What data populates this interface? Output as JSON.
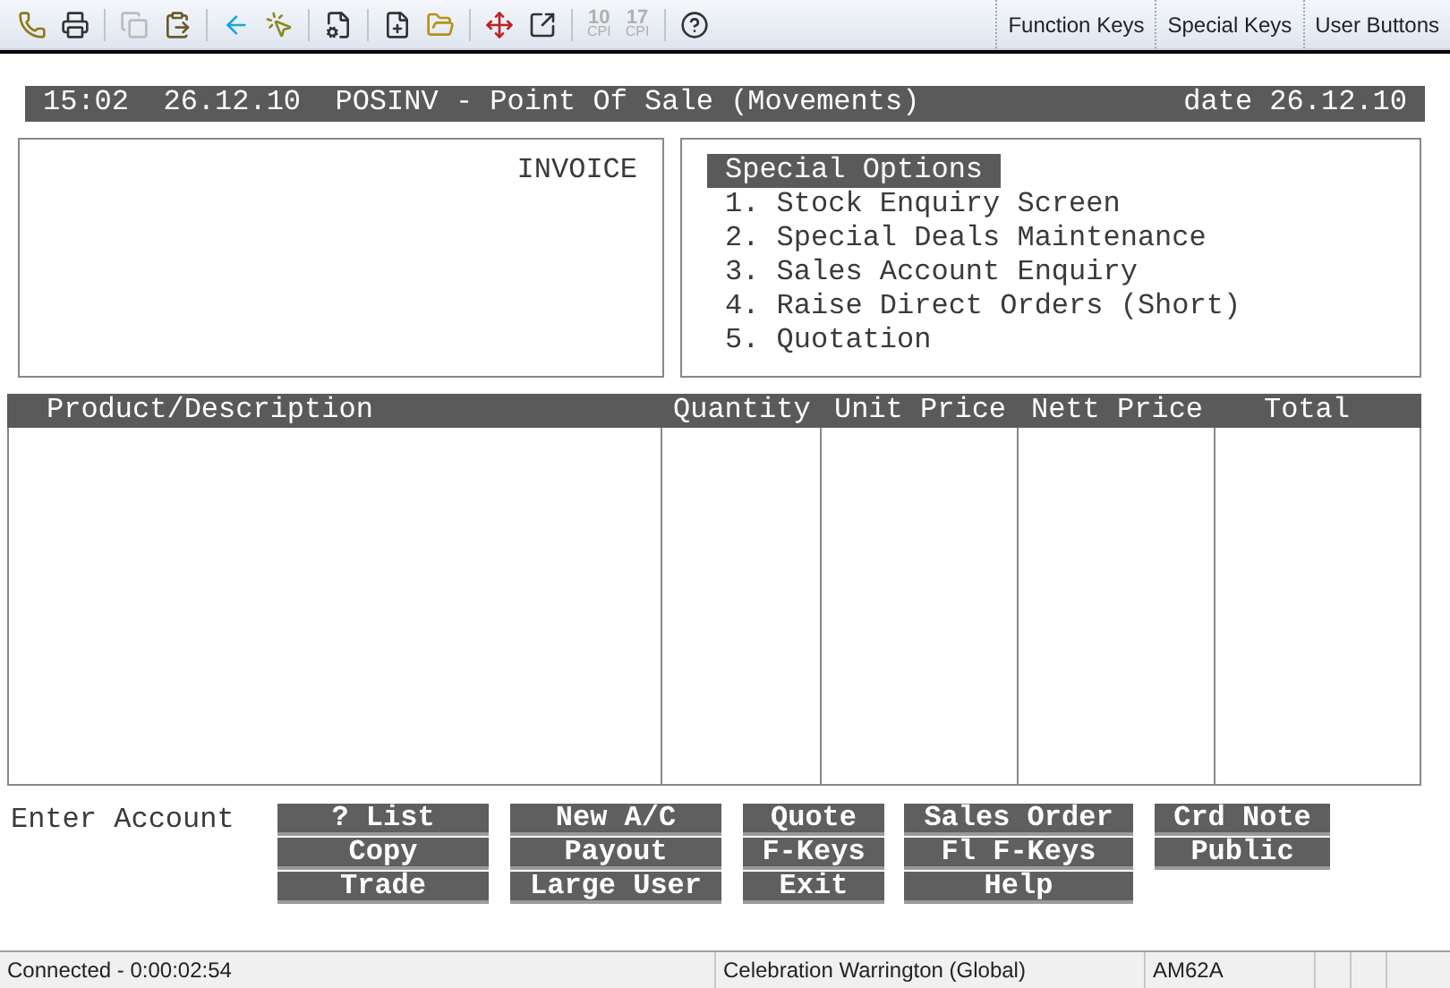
{
  "toolbar": {
    "items": [
      {
        "kind": "phone",
        "disabled": false
      },
      {
        "kind": "printer",
        "disabled": false
      },
      {
        "kind": "copy",
        "disabled": true
      },
      {
        "kind": "paste",
        "disabled": false
      },
      {
        "kind": "back",
        "disabled": false
      },
      {
        "kind": "pointer",
        "disabled": false
      },
      {
        "kind": "properties",
        "disabled": false
      },
      {
        "kind": "new",
        "disabled": false
      },
      {
        "kind": "open",
        "disabled": false
      },
      {
        "kind": "move",
        "disabled": false
      },
      {
        "kind": "export",
        "disabled": false
      },
      {
        "kind": "cpi",
        "number": "10",
        "unit": "CPI",
        "disabled": true
      },
      {
        "kind": "cpi",
        "number": "17",
        "unit": "CPI",
        "disabled": true
      },
      {
        "kind": "help",
        "disabled": false
      }
    ],
    "tabs": [
      "Function Keys",
      "Special Keys",
      "User Buttons"
    ]
  },
  "header": {
    "left": "15:02  26.12.10  POSINV - Point Of Sale (Movements)",
    "right": "date 26.12.10"
  },
  "invoice_panel": {
    "title": "INVOICE"
  },
  "special_options": {
    "title": "Special Options",
    "items": [
      "1. Stock Enquiry Screen",
      "2. Special Deals Maintenance",
      "3. Sales Account Enquiry",
      "4. Raise Direct Orders (Short)",
      "5. Quotation"
    ]
  },
  "table": {
    "columns": [
      "Product/Description",
      "Quantity",
      "Unit Price",
      "Nett Price",
      "Total"
    ]
  },
  "prompt": "Enter Account",
  "buttons": [
    [
      "? List",
      "Copy",
      "Trade"
    ],
    [
      "New A/C",
      "Payout",
      "Large User"
    ],
    [
      "Quote",
      "F-Keys",
      "Exit"
    ],
    [
      "Sales Order",
      "Fl F-Keys",
      "Help"
    ],
    [
      "Crd Note",
      "Public"
    ]
  ],
  "status_bar": [
    "Connected - 0:00:02:54",
    "Celebration Warrington (Global)",
    "AM62A"
  ]
}
